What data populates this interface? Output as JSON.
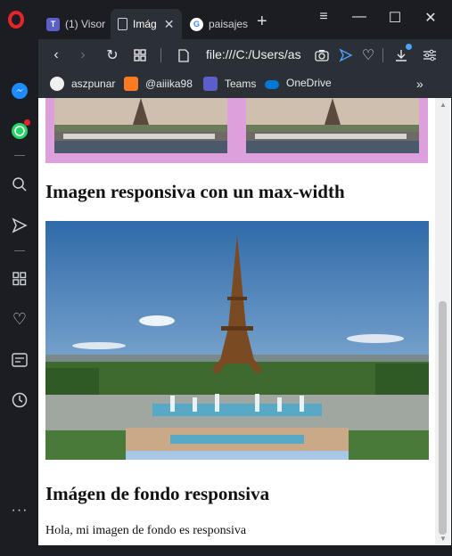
{
  "tabs": [
    {
      "label": "(1) Visor",
      "icon": "teams-icon",
      "color": "#5b5fc7",
      "active": false
    },
    {
      "label": "Imág",
      "icon": "document-icon",
      "active": true
    },
    {
      "label": "paisajes",
      "icon": "google-icon",
      "active": false
    }
  ],
  "address": {
    "url": "file:///C:/Users/as"
  },
  "bookmarks": [
    {
      "label": "aszpunar",
      "icon": "github-icon"
    },
    {
      "label": "@aiiika98",
      "icon": "xampp-icon",
      "color": "#fb7a24"
    },
    {
      "label": "Teams",
      "icon": "teams-icon",
      "color": "#5b5fc7"
    },
    {
      "label": "OneDrive",
      "icon": "onedrive-icon",
      "color": "#0078d4"
    }
  ],
  "page": {
    "heading_max_width": "Imagen responsiva con un max-width",
    "heading_background": "Imágen de fondo responsiva",
    "paragraph": "Hola, mi imagen de fondo es responsiva",
    "top_band_color": "#dda0dd"
  },
  "colors": {
    "opera_red": "#e8242b",
    "chrome_bg": "#1b1d22",
    "toolbar_bg": "#2b2f36",
    "accent": "#4aa3ff"
  }
}
